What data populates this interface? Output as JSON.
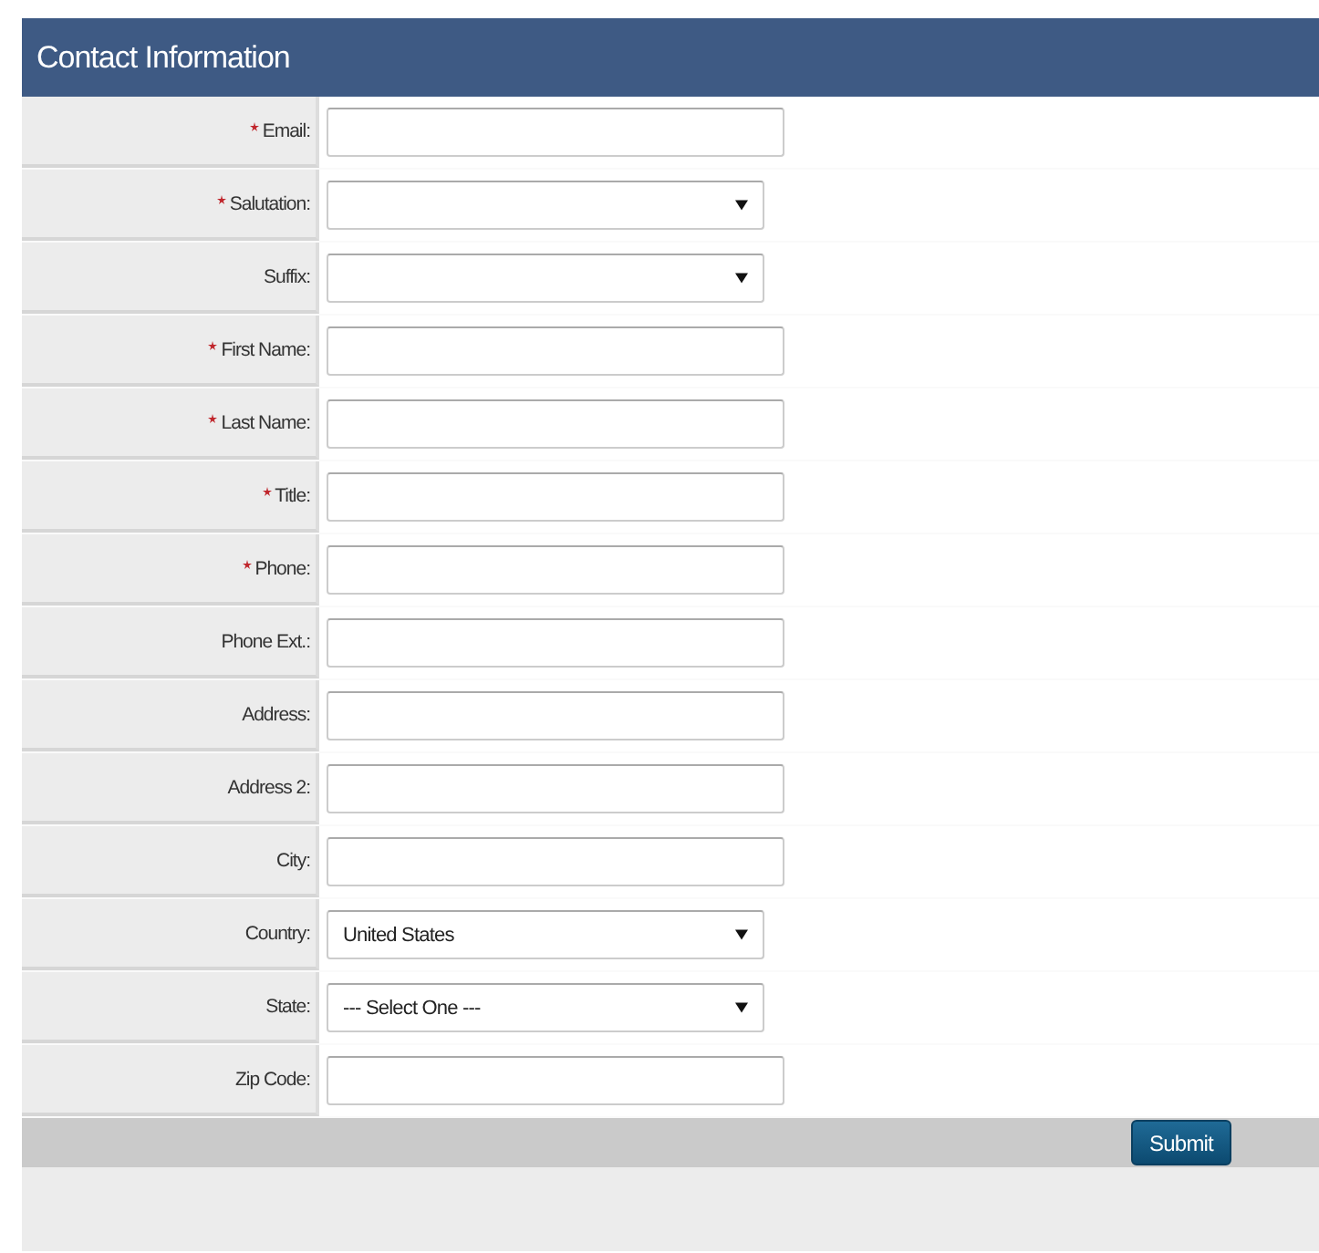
{
  "header": {
    "title": "Contact Information"
  },
  "fields": [
    {
      "label": "Email:",
      "required": true,
      "kind": "text"
    },
    {
      "label": "Salutation:",
      "required": true,
      "kind": "select"
    },
    {
      "label": "Suffix:",
      "required": false,
      "kind": "select"
    },
    {
      "label": "First Name:",
      "required": true,
      "kind": "text"
    },
    {
      "label": "Last Name:",
      "required": true,
      "kind": "text"
    },
    {
      "label": "Title:",
      "required": true,
      "kind": "text"
    },
    {
      "label": "Phone:",
      "required": true,
      "kind": "text"
    },
    {
      "label": "Phone Ext.:",
      "required": false,
      "kind": "text"
    },
    {
      "label": "Address:",
      "required": false,
      "kind": "text"
    },
    {
      "label": "Address 2:",
      "required": false,
      "kind": "text"
    },
    {
      "label": "City:",
      "required": false,
      "kind": "text"
    },
    {
      "label": "Country:",
      "required": false,
      "kind": "select",
      "value": "United States"
    },
    {
      "label": "State:",
      "required": false,
      "kind": "select",
      "value": "--- Select One ---"
    },
    {
      "label": "Zip Code:",
      "required": false,
      "kind": "text"
    }
  ],
  "footer": {
    "button": "Submit"
  }
}
